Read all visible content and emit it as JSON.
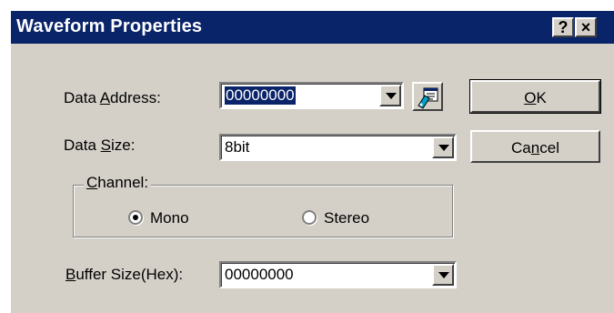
{
  "window": {
    "title": "Waveform Properties",
    "help_button": "?",
    "close_button": "×"
  },
  "fields": {
    "data_address": {
      "label_pre": "Data ",
      "label_accel": "A",
      "label_post": "ddress:",
      "value": "00000000"
    },
    "data_size": {
      "label_pre": "Data ",
      "label_accel": "S",
      "label_post": "ize:",
      "value": "8bit"
    },
    "buffer_size": {
      "label_pre": "",
      "label_accel": "B",
      "label_post": "uffer Size(Hex):",
      "value": "00000000"
    }
  },
  "channel": {
    "legend_pre": "",
    "legend_accel": "C",
    "legend_post": "hannel:",
    "options": [
      {
        "label": "Mono",
        "selected": true
      },
      {
        "label": "Stereo",
        "selected": false
      }
    ]
  },
  "buttons": {
    "ok_accel": "O",
    "ok_post": "K",
    "cancel_pre": "Ca",
    "cancel_accel": "n",
    "cancel_post": "cel"
  },
  "icons": {
    "address_picker": "memory-browse-icon"
  },
  "colors": {
    "titlebar": "#0a246a",
    "face": "#d4d0c8",
    "selection": "#0a246a"
  }
}
